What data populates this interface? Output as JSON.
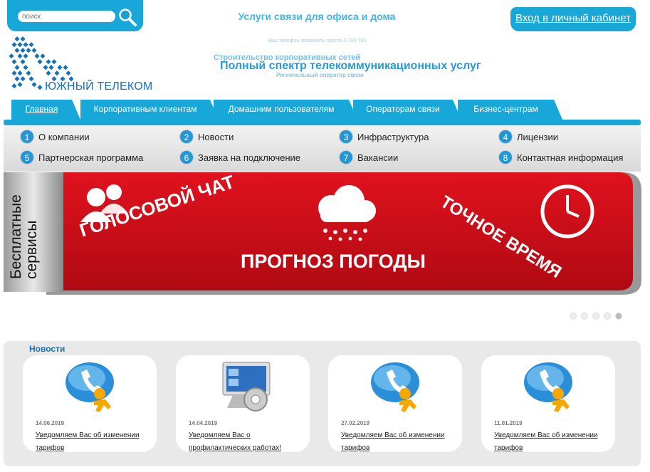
{
  "search": {
    "placeholder": "поиск"
  },
  "header": {
    "top_title": "Услуги связи для офиса и дома",
    "cabinet_link": "Вход в личный кабинет",
    "phone_note": "Ваш телефон запомнить просто 2-700-700",
    "logo_text": "ЮЖНЫЙ ТЕЛЕКОМ",
    "slogan_small": "Строительство корпоративных сетей",
    "slogan_main": "Полный спектр телекоммуникационных услуг",
    "slogan_sub": "Региональный оператор связи"
  },
  "tabs": [
    {
      "label": "Главная",
      "active": true
    },
    {
      "label": "Корпоративным клиентам"
    },
    {
      "label": "Домашним пользователям"
    },
    {
      "label": "Операторам связи"
    },
    {
      "label": "Бизнес-центрам"
    }
  ],
  "submenu": [
    {
      "num": "1",
      "label": "О компании"
    },
    {
      "num": "2",
      "label": "Новости"
    },
    {
      "num": "3",
      "label": "Инфраструктура"
    },
    {
      "num": "4",
      "label": "Лицензии"
    },
    {
      "num": "5",
      "label": "Партнерская программа"
    },
    {
      "num": "6",
      "label": "Заявка на подключение"
    },
    {
      "num": "7",
      "label": "Вакансии"
    },
    {
      "num": "8",
      "label": "Контактная информация"
    }
  ],
  "banner": {
    "side_label_1": "Бесплатные",
    "side_label_2": "сервисы",
    "voice_chat": "ГОЛОСОВОЙ ЧАТ",
    "weather": "ПРОГНОЗ ПОГОДЫ",
    "exact_time": "ТОЧНОЕ ВРЕМЯ",
    "active_slide": 5,
    "slides": 5
  },
  "news": {
    "title": "Новости",
    "items": [
      {
        "date": "14.06.2019",
        "text": "Уведомляем Вас об изменении тарифов",
        "icon": "phone-bubble-icon"
      },
      {
        "date": "14.04.2019",
        "text": "Уведомляем Вас о профилактических работах!",
        "icon": "monitor-gear-icon"
      },
      {
        "date": "27.02.2019",
        "text": "Уведомляем Вас об изменении тарифов",
        "icon": "phone-bubble-icon"
      },
      {
        "date": "11.01.2019",
        "text": "Уведомляем Вас об изменении тарифов",
        "icon": "phone-bubble-icon"
      }
    ]
  },
  "colors": {
    "accent": "#17a7d9",
    "banner_red": "#d0101a"
  }
}
